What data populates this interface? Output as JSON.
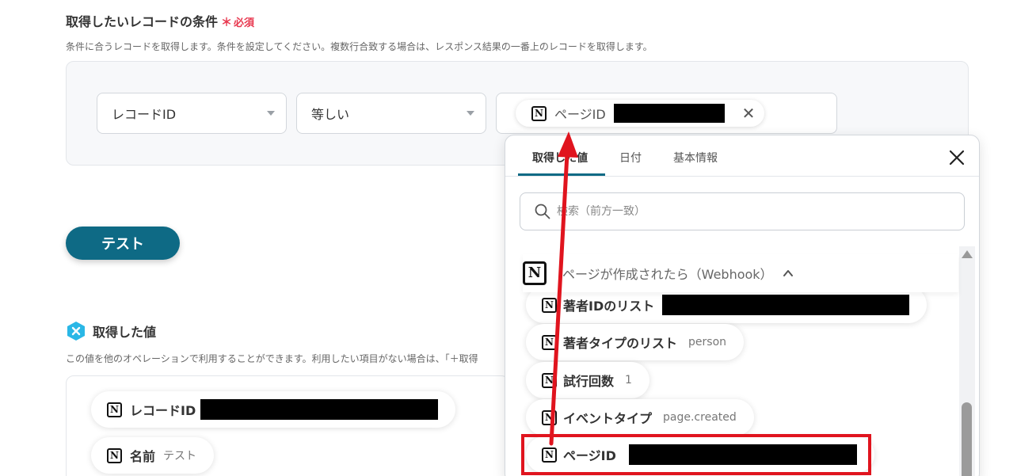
{
  "condition_section": {
    "title": "取得したいレコードの条件",
    "required_mark": "＊",
    "required_text": "必須",
    "description": "条件に合うレコードを取得します。条件を設定してください。複数行合致する場合は、レスポンス結果の一番上のレコードを取得します。",
    "field_select": "レコードID",
    "operator_select": "等しい",
    "value_chip_label": "ページID",
    "value_chip_close": "✕"
  },
  "test_button": {
    "label": "テスト"
  },
  "output_section": {
    "title": "取得した値",
    "description": "この値を他のオペレーションで利用することができます。利用したい項目がない場合は、「＋取得",
    "items": [
      {
        "label": "レコードID",
        "value": ""
      },
      {
        "label": "名前",
        "value": "テスト"
      }
    ]
  },
  "variable_panel": {
    "tabs": [
      "取得した値",
      "日付",
      "基本情報"
    ],
    "active_tab": 0,
    "search_placeholder": "検索（前方一致）",
    "group_title": "ページが作成されたら（Webhook）",
    "items": [
      {
        "label": "著者IDのリスト",
        "value": ""
      },
      {
        "label": "著者タイプのリスト",
        "value": "person"
      },
      {
        "label": "試行回数",
        "value": "1"
      },
      {
        "label": "イベントタイプ",
        "value": "page.created"
      },
      {
        "label": "ページID",
        "value": ""
      }
    ]
  },
  "colors": {
    "accent": "#0e6a85",
    "required": "#e8384f",
    "highlight": "#e0141e",
    "arrow": "#e0141e"
  },
  "icons": {
    "notion": "N"
  }
}
